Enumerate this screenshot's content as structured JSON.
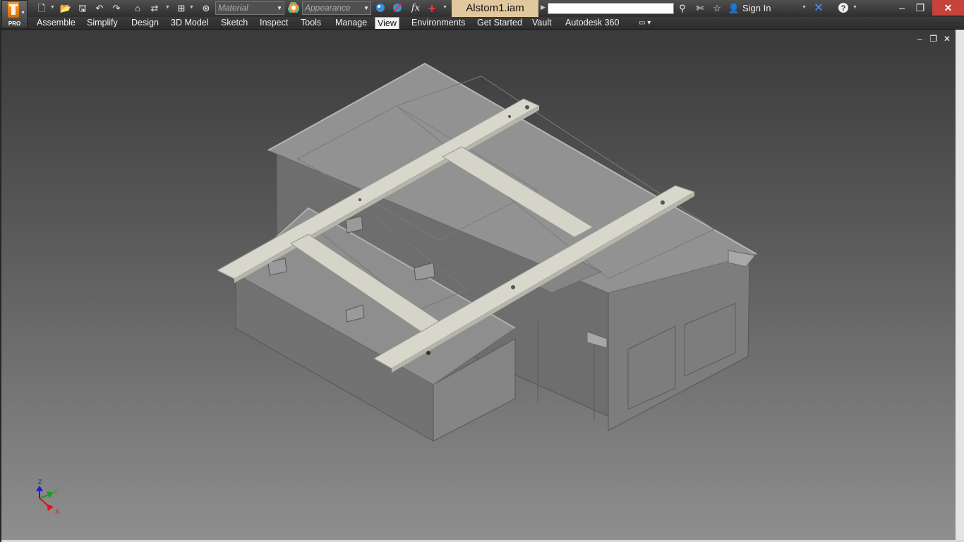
{
  "app": {
    "badge": "PRO",
    "document_title": "Alstom1.iam"
  },
  "quick_access": {
    "material_placeholder": "Material",
    "appearance_placeholder": "Appearance",
    "fx_label": "fx",
    "sign_in": "Sign In"
  },
  "ribbon": {
    "tabs": [
      "Assemble",
      "Simplify",
      "Design",
      "3D Model",
      "Sketch",
      "Inspect",
      "Tools",
      "Manage",
      "View",
      "Environments",
      "Get Started",
      "Vault",
      "Autodesk 360"
    ],
    "active_tab": "View"
  },
  "triad": {
    "z": "Z",
    "y": "Y",
    "x": "X"
  },
  "colors": {
    "accent": "#e2c89d",
    "close": "#c7423a",
    "model_gray": "#8c8c8c",
    "rail": "#cfcfc5"
  }
}
